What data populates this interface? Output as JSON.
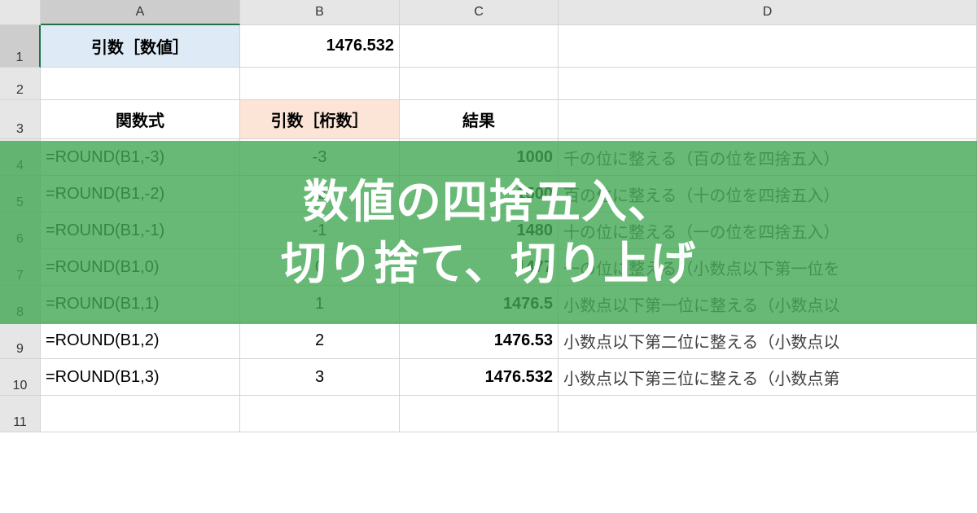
{
  "columns": {
    "A": "A",
    "B": "B",
    "C": "C",
    "D": "D"
  },
  "row_labels": [
    "1",
    "2",
    "3",
    "4",
    "5",
    "6",
    "7",
    "8",
    "9",
    "10",
    "11"
  ],
  "header1": {
    "a": "引数［数値］",
    "b": "1476.532"
  },
  "header3": {
    "a": "関数式",
    "b": "引数［桁数］",
    "c": "結果"
  },
  "rows": [
    {
      "formula": "=ROUND(B1,-3)",
      "digits": "-3",
      "result": "1000",
      "desc": "千の位に整える（百の位を四捨五入）"
    },
    {
      "formula": "=ROUND(B1,-2)",
      "digits": "-2",
      "result": "1500",
      "desc": "百の位に整える（十の位を四捨五入）"
    },
    {
      "formula": "=ROUND(B1,-1)",
      "digits": "-1",
      "result": "1480",
      "desc": "十の位に整える（一の位を四捨五入）"
    },
    {
      "formula": "=ROUND(B1,0)",
      "digits": "0",
      "result": "1477",
      "desc": "一の位に整える（小数点以下第一位を"
    },
    {
      "formula": "=ROUND(B1,1)",
      "digits": "1",
      "result": "1476.5",
      "desc": "小数点以下第一位に整える（小数点以"
    },
    {
      "formula": "=ROUND(B1,2)",
      "digits": "2",
      "result": "1476.53",
      "desc": "小数点以下第二位に整える（小数点以"
    },
    {
      "formula": "=ROUND(B1,3)",
      "digits": "3",
      "result": "1476.532",
      "desc": "小数点以下第三位に整える（小数点第"
    }
  ],
  "overlay": {
    "line1": "数値の四捨五入、",
    "line2": "切り捨て、切り上げ"
  }
}
